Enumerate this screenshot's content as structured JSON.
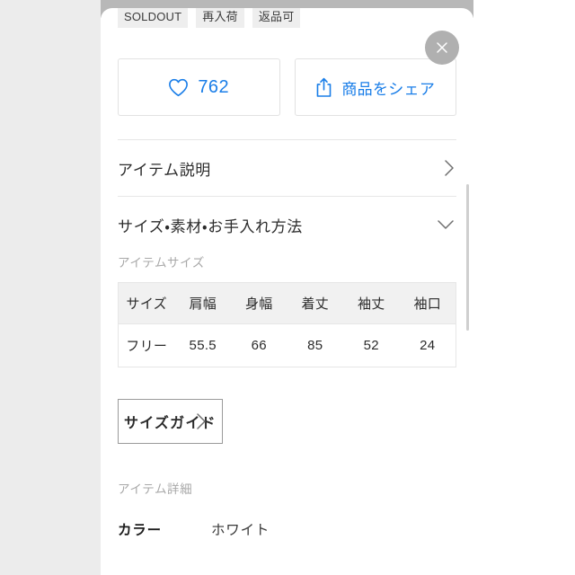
{
  "meta": {
    "accent_blue": "#1a7ee8",
    "text_dark": "#2b2b2b",
    "muted_gray": "#a8a8a8",
    "border_gray": "#e6e6e6",
    "badge_bg": "#eeeeee",
    "table_header_bg": "#f1f1f1",
    "backdrop_gray": "#ececec"
  },
  "badges": [
    {
      "label": "SOLDOUT"
    },
    {
      "label": "再入荷"
    },
    {
      "label": "返品可"
    }
  ],
  "close_button": {
    "icon": "close-icon",
    "aria_label": "閉じる"
  },
  "actions": {
    "like": {
      "icon": "heart-outline-icon",
      "count": "762"
    },
    "share": {
      "icon": "share-icon",
      "label": "商品をシェア"
    }
  },
  "accordions": [
    {
      "title": "アイテム説明",
      "icon": "chevron-right-icon",
      "expanded": false
    },
    {
      "title": "サイズ・素材・お手入れ方法",
      "icon": "chevron-down-icon",
      "expanded": true
    }
  ],
  "item_size": {
    "label": "アイテムサイズ",
    "columns": [
      "サイズ",
      "肩幅",
      "身幅",
      "着丈",
      "袖丈",
      "袖口"
    ],
    "rows": [
      [
        "フリー",
        "55.5",
        "66",
        "85",
        "52",
        "24"
      ]
    ]
  },
  "size_guide": {
    "label": "サイズガイド",
    "icon": "chevron-right-icon"
  },
  "item_detail": {
    "label": "アイテム詳細",
    "rows": [
      {
        "key": "カラー",
        "value": "ホワイト"
      }
    ]
  },
  "scrollbar": {
    "name": "vertical-scrollbar"
  }
}
